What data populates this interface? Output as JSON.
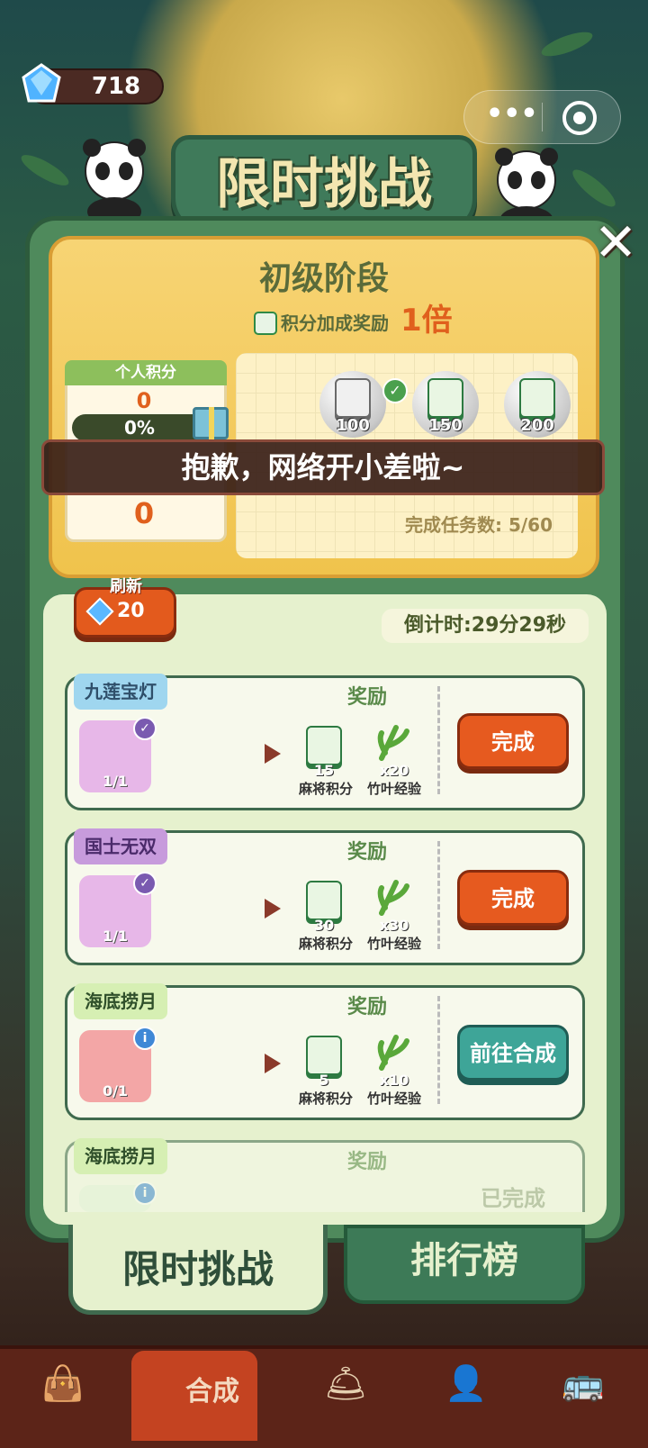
{
  "hud": {
    "gems": "718"
  },
  "title": "限时挑战",
  "stage": {
    "name": "初级阶段",
    "bonus_label": "积分加成奖励",
    "bonus_mult": "1倍"
  },
  "score": {
    "header": "个人积分",
    "value": "0",
    "percent": "0%",
    "value2": "0"
  },
  "milestones": [
    {
      "value": "100",
      "claimed": true
    },
    {
      "value": "150",
      "claimed": false
    },
    {
      "value": "200",
      "claimed": false
    }
  ],
  "tasks_done": "完成任务数:  5/60",
  "toast": "抱歉，网络开小差啦~",
  "refresh": {
    "label": "刷新",
    "cost": "20"
  },
  "countdown": "倒计时:29分29秒",
  "reward_header": "奖励",
  "reward_labels": {
    "mahjong": "麻将积分",
    "leaf": "竹叶经验"
  },
  "tasks": [
    {
      "tag": "九莲宝灯",
      "progress": "1/1",
      "points": "15",
      "leaves": "x20",
      "button": "完成",
      "color": "#9fd6ef"
    },
    {
      "tag": "国士无双",
      "progress": "1/1",
      "points": "30",
      "leaves": "x30",
      "button": "完成",
      "color": "#c79bdc"
    },
    {
      "tag": "海底捞月",
      "progress": "0/1",
      "points": "5",
      "leaves": "x10",
      "button": "前往合成",
      "color": "#d6efb3"
    },
    {
      "tag": "海底捞月",
      "progress": "",
      "points": "",
      "leaves": "",
      "button": "已完成",
      "color": "#d6efb3"
    }
  ],
  "tabs": {
    "active": "限时挑战",
    "other": "排行榜"
  },
  "nav": {
    "active_label": "合成"
  },
  "colors": {
    "orange": "#e65a1f",
    "teal": "#3ea598",
    "panel_green": "#4f8a5c"
  }
}
